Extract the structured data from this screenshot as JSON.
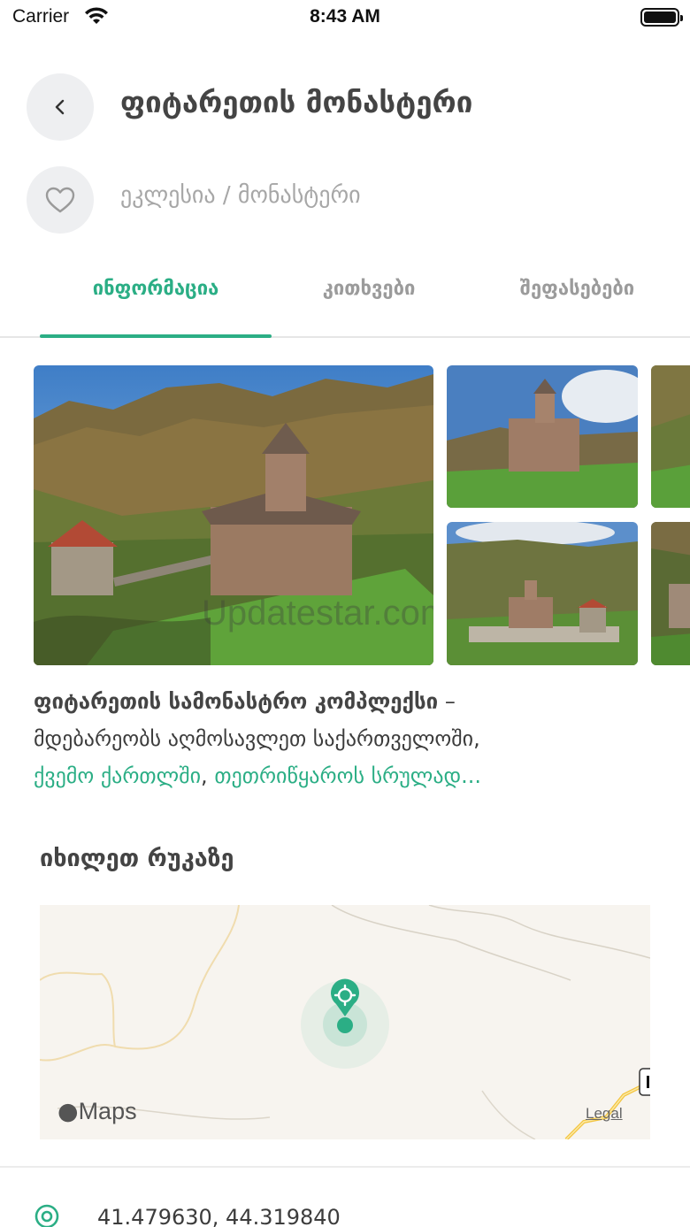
{
  "status_bar": {
    "carrier": "Carrier",
    "time": "8:43 AM"
  },
  "header": {
    "title": "ფიტარეთის მონასტერი",
    "subtitle": "ეკლესია / მონასტერი",
    "back_icon": "chevron-left-icon",
    "favorite_icon": "heart-outline-icon"
  },
  "tabs": [
    {
      "label": "ინფორმაცია",
      "active": true
    },
    {
      "label": "კითხვები",
      "active": false
    },
    {
      "label": "შეფასებები",
      "active": false
    }
  ],
  "gallery": {
    "photo_count_visible": 5,
    "watermark": "Updatestar.com"
  },
  "description": {
    "bold_text": "ფიტარეთის სამონასტრო კომპლექსი",
    "dash": " – ",
    "text": "მდებარეობს აღმოსავლეთ საქართველოში,",
    "link1": "ქვემო ქართლში",
    "comma": ", ",
    "link2": "თეთრიწყაროს სრულად..."
  },
  "map_section": {
    "title": "იხილეთ რუკაზე",
    "maps_label": "Maps",
    "legal_label": "Legal",
    "pin_icon": "map-pin-icon"
  },
  "location": {
    "icon": "location-target-icon",
    "coordinates": "41.479630, 44.319840"
  },
  "colors": {
    "accent": "#2bae85",
    "button_bg": "#eeeff1",
    "muted_text": "#a7a7a7"
  }
}
